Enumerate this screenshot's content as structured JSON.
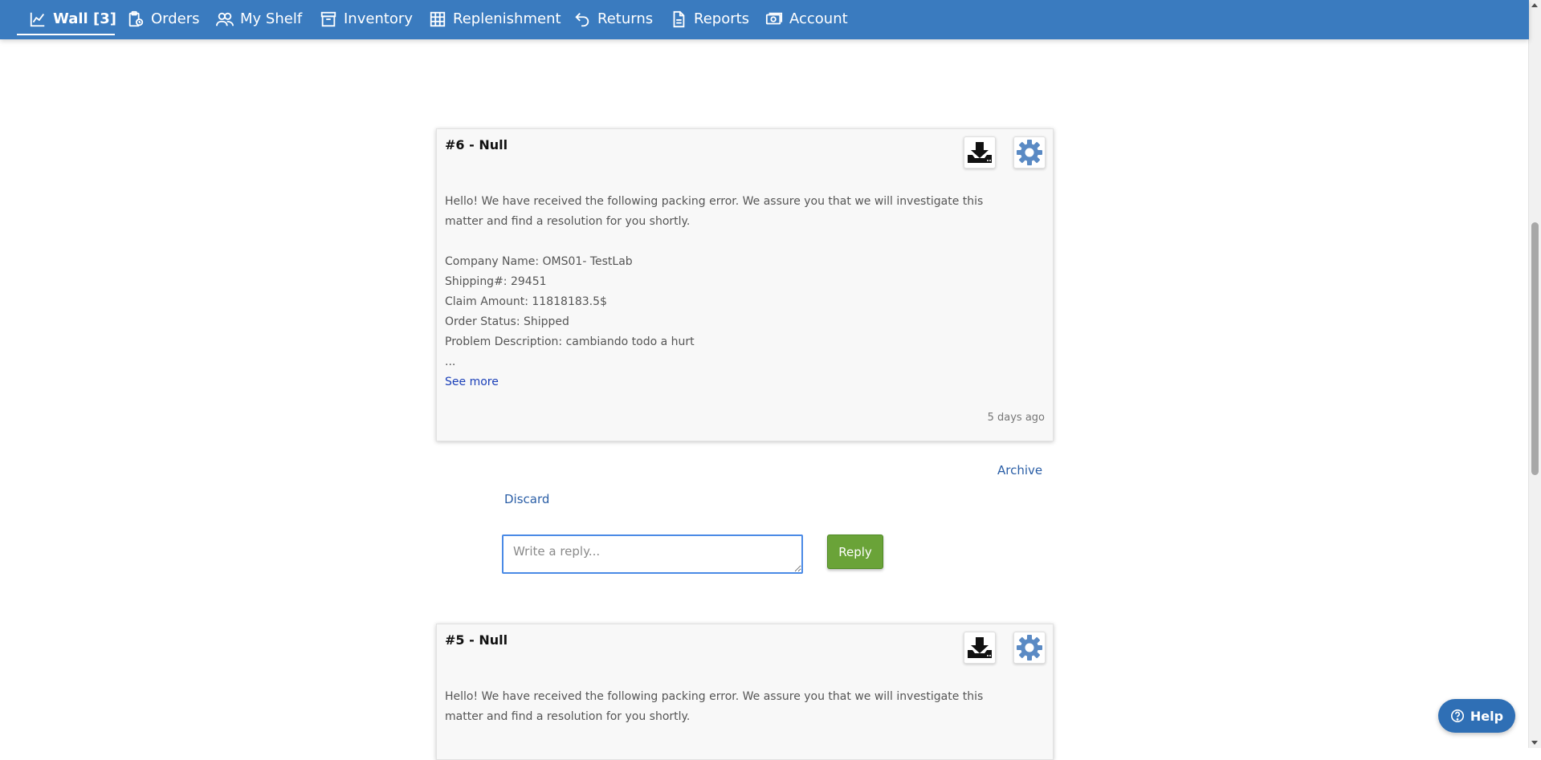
{
  "nav": {
    "items": [
      {
        "label": "Wall [3]",
        "icon": "chart-line-icon",
        "active": true
      },
      {
        "label": "Orders",
        "icon": "clipboard-clock-icon"
      },
      {
        "label": "My Shelf",
        "icon": "users-icon"
      },
      {
        "label": "Inventory",
        "icon": "archive-box-icon"
      },
      {
        "label": "Replenishment",
        "icon": "grid-icon"
      },
      {
        "label": "Returns",
        "icon": "undo-arrow-icon"
      },
      {
        "label": "Reports",
        "icon": "document-icon"
      },
      {
        "label": "Account",
        "icon": "money-icon"
      }
    ],
    "color": "#3a7bbf"
  },
  "posts": [
    {
      "title": "#6 - Null",
      "intro": "Hello! We have received the following packing error. We assure you that we will investigate this matter and find a resolution for you shortly.",
      "company": "Company Name: OMS01- TestLab",
      "shipping": "Shipping#: 29451",
      "claim": "Claim Amount: 11818183.5$",
      "status": "Order Status: Shipped",
      "problem": "Problem Description: cambiando todo a hurt",
      "ellipsis": "...",
      "see_more": "See more",
      "timestamp": "5 days ago"
    },
    {
      "title": "#5 - Null",
      "intro": "Hello! We have received the following packing error. We assure you that we will investigate this matter and find a resolution for you shortly."
    }
  ],
  "actions": {
    "archive": "Archive",
    "discard": "Discard",
    "reply_placeholder": "Write a reply...",
    "reply_button": "Reply",
    "reply_color": "#6aa338"
  },
  "help": {
    "label": "Help"
  }
}
